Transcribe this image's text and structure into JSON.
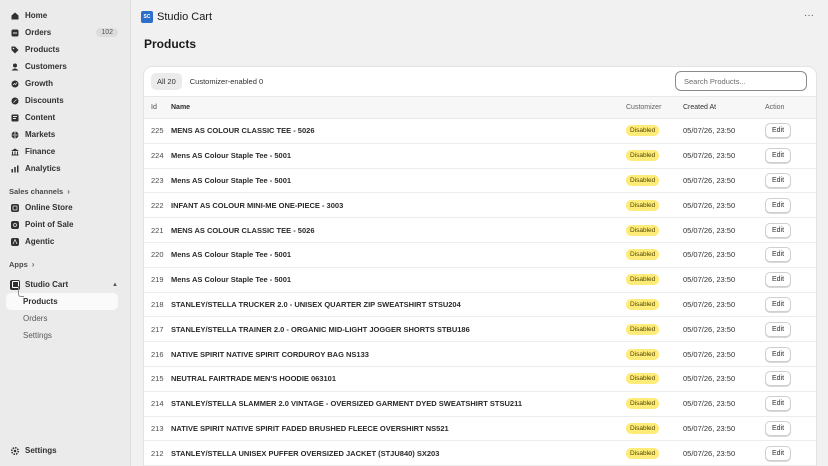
{
  "sidebar": {
    "nav": [
      {
        "label": "Home",
        "icon": "home-icon"
      },
      {
        "label": "Orders",
        "icon": "orders-icon",
        "badge": "102"
      },
      {
        "label": "Products",
        "icon": "tag-icon"
      },
      {
        "label": "Customers",
        "icon": "person-icon"
      },
      {
        "label": "Growth",
        "icon": "growth-icon"
      },
      {
        "label": "Discounts",
        "icon": "discount-icon"
      },
      {
        "label": "Content",
        "icon": "content-icon"
      },
      {
        "label": "Markets",
        "icon": "globe-icon"
      },
      {
        "label": "Finance",
        "icon": "bank-icon"
      },
      {
        "label": "Analytics",
        "icon": "chart-icon"
      }
    ],
    "sales_channels_label": "Sales channels",
    "channels": [
      {
        "label": "Online Store",
        "icon": "online-store-icon"
      },
      {
        "label": "Point of Sale",
        "icon": "pos-icon"
      },
      {
        "label": "Agentic",
        "icon": "agentic-icon"
      }
    ],
    "apps_label": "Apps",
    "app_name": "Studio Cart",
    "app_sub": [
      "Products",
      "Orders",
      "Settings"
    ],
    "settings_label": "Settings"
  },
  "header": {
    "app_logo_text": "SC",
    "app_title": "Studio Cart",
    "page_title": "Products"
  },
  "filters": {
    "all": "All 20",
    "customizer": "Customizer-enabled 0",
    "search_placeholder": "Search Products..."
  },
  "table": {
    "headers": [
      "Id",
      "Name",
      "Customizer",
      "Created At",
      "Action"
    ],
    "rows": [
      {
        "id": "225",
        "name": "MENS AS COLOUR CLASSIC TEE - 5026",
        "status": "Disabled",
        "created": "05/07/26, 23:50",
        "action": "Edit"
      },
      {
        "id": "224",
        "name": "Mens AS Colour Staple Tee - 5001",
        "status": "Disabled",
        "created": "05/07/26, 23:50",
        "action": "Edit"
      },
      {
        "id": "223",
        "name": "Mens AS Colour Staple Tee - 5001",
        "status": "Disabled",
        "created": "05/07/26, 23:50",
        "action": "Edit"
      },
      {
        "id": "222",
        "name": "INFANT AS COLOUR MINI-ME ONE-PIECE - 3003",
        "status": "Disabled",
        "created": "05/07/26, 23:50",
        "action": "Edit"
      },
      {
        "id": "221",
        "name": "MENS AS COLOUR CLASSIC TEE - 5026",
        "status": "Disabled",
        "created": "05/07/26, 23:50",
        "action": "Edit"
      },
      {
        "id": "220",
        "name": "Mens AS Colour Staple Tee - 5001",
        "status": "Disabled",
        "created": "05/07/26, 23:50",
        "action": "Edit"
      },
      {
        "id": "219",
        "name": "Mens AS Colour Staple Tee - 5001",
        "status": "Disabled",
        "created": "05/07/26, 23:50",
        "action": "Edit"
      },
      {
        "id": "218",
        "name": "STANLEY/STELLA TRUCKER 2.0 - UNISEX QUARTER ZIP SWEATSHIRT STSU204",
        "status": "Disabled",
        "created": "05/07/26, 23:50",
        "action": "Edit"
      },
      {
        "id": "217",
        "name": "STANLEY/STELLA TRAINER 2.0 - ORGANIC MID-LIGHT JOGGER SHORTS STBU186",
        "status": "Disabled",
        "created": "05/07/26, 23:50",
        "action": "Edit"
      },
      {
        "id": "216",
        "name": "NATIVE SPIRIT NATIVE SPIRIT CORDUROY BAG NS133",
        "status": "Disabled",
        "created": "05/07/26, 23:50",
        "action": "Edit"
      },
      {
        "id": "215",
        "name": "NEUTRAL FAIRTRADE MEN'S HOODIE 063101",
        "status": "Disabled",
        "created": "05/07/26, 23:50",
        "action": "Edit"
      },
      {
        "id": "214",
        "name": "STANLEY/STELLA SLAMMER 2.0 VINTAGE - OVERSIZED GARMENT DYED SWEATSHIRT STSU211",
        "status": "Disabled",
        "created": "05/07/26, 23:50",
        "action": "Edit"
      },
      {
        "id": "213",
        "name": "NATIVE SPIRIT NATIVE SPIRIT FADED BRUSHED FLEECE OVERSHIRT NS521",
        "status": "Disabled",
        "created": "05/07/26, 23:50",
        "action": "Edit"
      },
      {
        "id": "212",
        "name": "STANLEY/STELLA UNISEX PUFFER OVERSIZED JACKET (STJU840) SX203",
        "status": "Disabled",
        "created": "05/07/26, 23:50",
        "action": "Edit"
      }
    ]
  },
  "colors": {
    "accent": "#2c6ecb",
    "status_disabled": "#ffeb78"
  }
}
